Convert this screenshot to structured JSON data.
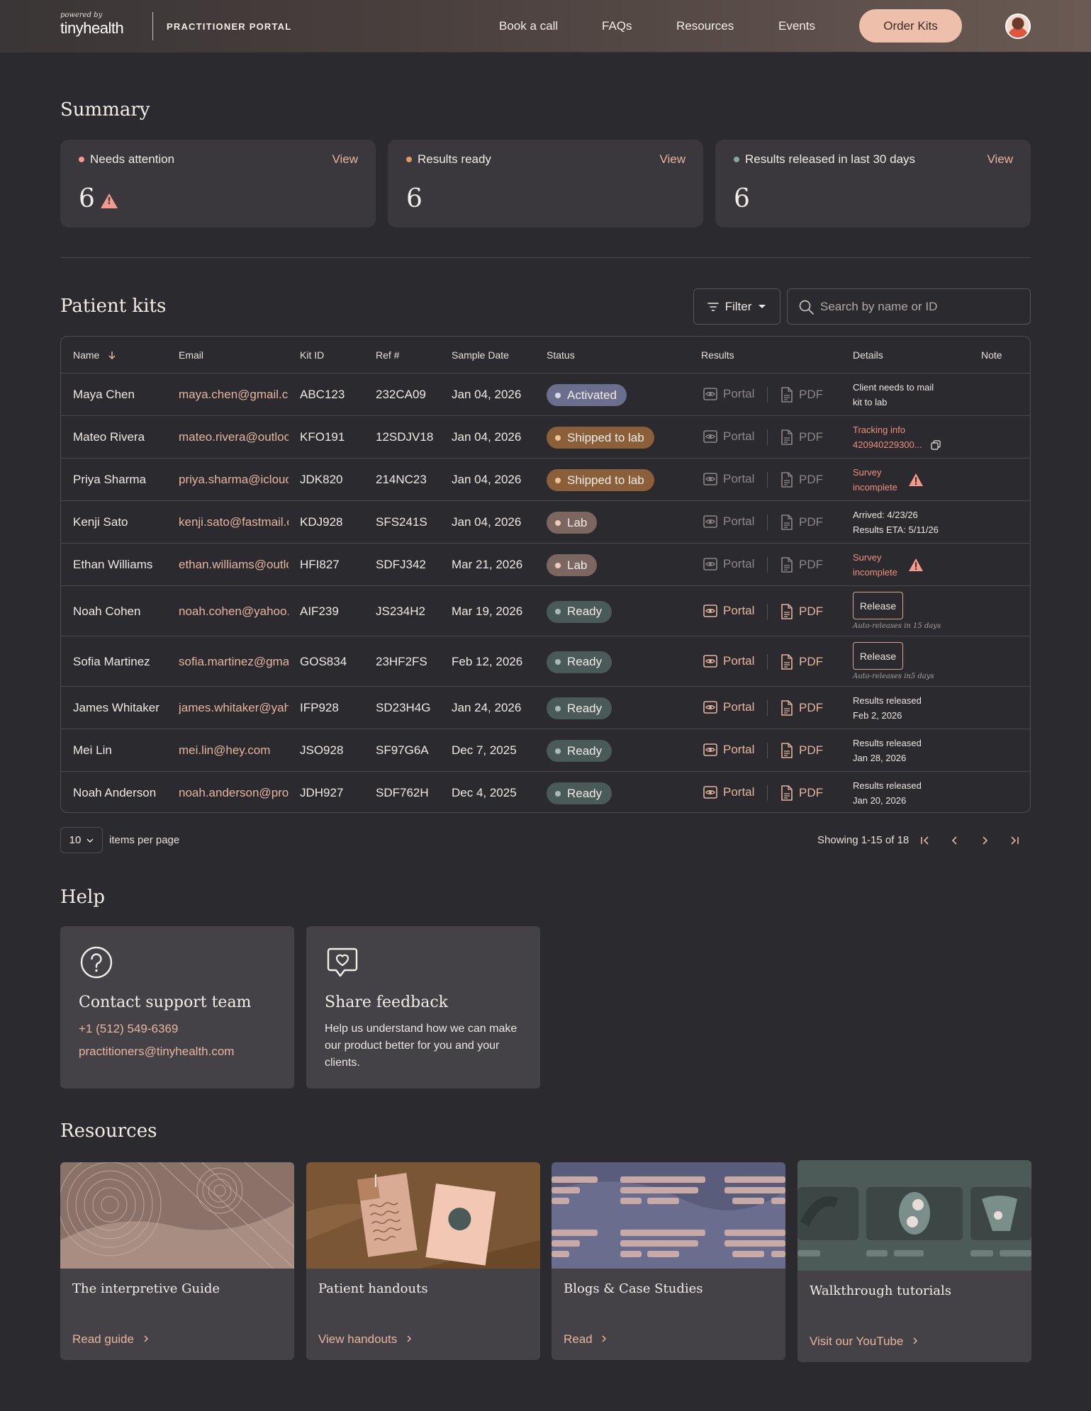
{
  "header": {
    "powered_by": "powered by",
    "brand": "tinyhealth",
    "portal_label": "PRACTITIONER PORTAL",
    "nav": [
      "Book a call",
      "FAQs",
      "Resources",
      "Events"
    ],
    "order_button": "Order Kits"
  },
  "summary": {
    "title": "Summary",
    "cards": [
      {
        "label": "Needs attention",
        "value": "6",
        "action": "View",
        "dot_color": "#f49a8c"
      },
      {
        "label": "Results ready",
        "value": "6",
        "action": "View",
        "dot_color": "#d89a66"
      },
      {
        "label": "Results released in last 30 days",
        "value": "6",
        "action": "View",
        "dot_color": "#8fa49e"
      }
    ]
  },
  "patient_kits": {
    "title": "Patient kits",
    "filter_label": "Filter",
    "search_placeholder": "Search by name or ID",
    "columns": [
      "Name",
      "Email",
      "Kit ID",
      "Ref #",
      "Sample Date",
      "Status",
      "Results",
      "Details",
      "Note"
    ],
    "portal_label": "Portal",
    "pdf_label": "PDF",
    "rows": [
      {
        "name": "Maya Chen",
        "email": "maya.chen@gmail.c",
        "kit": "ABC123",
        "ref": "232CA09",
        "date": "Jan 04, 2026",
        "status": "Activated",
        "details": [
          "Client needs to mail",
          "kit to lab"
        ]
      },
      {
        "name": "Mateo Rivera",
        "email": "mateo.rivera@outloc",
        "kit": "KFO191",
        "ref": "12SDJV18",
        "date": "Jan 04, 2026",
        "status": "Shipped to lab",
        "details": [
          "Tracking info",
          "420940229300..."
        ]
      },
      {
        "name": "Priya Sharma",
        "email": "priya.sharma@icloud",
        "kit": "JDK820",
        "ref": "214NC23",
        "date": "Jan 04, 2026",
        "status": "Shipped to lab",
        "details": [
          "Survey",
          "incomplete"
        ]
      },
      {
        "name": "Kenji Sato",
        "email": "kenji.sato@fastmail.c",
        "kit": "KDJ928",
        "ref": "SFS241S",
        "date": "Jan 04, 2026",
        "status": "Lab",
        "details": [
          "Arrived: 4/23/26",
          "Results ETA: 5/11/26"
        ]
      },
      {
        "name": "Ethan Williams",
        "email": "ethan.williams@outlc",
        "kit": "HFI827",
        "ref": "SDFJ342",
        "date": "Mar 21, 2026",
        "status": "Lab",
        "details": [
          "Survey",
          "incomplete"
        ]
      },
      {
        "name": "Noah Cohen",
        "email": "noah.cohen@yahoo.",
        "kit": "AIF239",
        "ref": "JS234H2",
        "date": "Mar 19, 2026",
        "status": "Ready",
        "release": "Release",
        "auto_note": "Auto-releases in 15 days"
      },
      {
        "name": "Sofia Martinez",
        "email": "sofia.martinez@gma",
        "kit": "GOS834",
        "ref": "23HF2FS",
        "date": "Feb 12, 2026",
        "status": "Ready",
        "release": "Release",
        "auto_note": "Auto-releases in5 days"
      },
      {
        "name": "James Whitaker",
        "email": "james.whitaker@yah",
        "kit": "IFP928",
        "ref": "SD23H4G",
        "date": "Jan 24, 2026",
        "status": "Ready",
        "details": [
          "Results released",
          "Feb 2, 2026"
        ]
      },
      {
        "name": "Mei Lin",
        "email": "mei.lin@hey.com",
        "kit": "JSO928",
        "ref": "SF97G6A",
        "date": "Dec 7, 2025",
        "status": "Ready",
        "details": [
          "Results released",
          "Jan 28, 2026"
        ]
      },
      {
        "name": "Noah Anderson",
        "email": "noah.anderson@pro",
        "kit": "JDH927",
        "ref": "SDF762H",
        "date": "Dec 4, 2025",
        "status": "Ready",
        "details": [
          "Results released",
          "Jan 20, 2026"
        ]
      }
    ],
    "status_colors": {
      "Activated": {
        "bg": "#6b6e8c",
        "dot": "#d7d9ea"
      },
      "Shipped to lab": {
        "bg": "#8a5f3a",
        "dot": "#f0c390"
      },
      "Lab": {
        "bg": "#7c6660",
        "dot": "#eec9b8"
      },
      "Ready": {
        "bg": "#4a5a58",
        "dot": "#aab9b5"
      }
    }
  },
  "pagination": {
    "per_page": "10",
    "per_page_label": "items per page",
    "showing": "Showing 1-15 of 18"
  },
  "help": {
    "title": "Help",
    "support": {
      "title": "Contact support team",
      "phone": "+1 (512) 549-6369",
      "email": "practitioners@tinyhealth.com"
    },
    "feedback": {
      "title": "Share feedback",
      "text": "Help us understand how we can make our product better for you and your clients."
    }
  },
  "resources": {
    "title": "Resources",
    "cards": [
      {
        "title": "The interpretive Guide",
        "link": "Read guide"
      },
      {
        "title": "Patient handouts",
        "link": "View handouts"
      },
      {
        "title": "Blogs & Case Studies",
        "link": "Read"
      },
      {
        "title": "Walkthrough tutorials",
        "link": "Visit our YouTube"
      }
    ]
  }
}
